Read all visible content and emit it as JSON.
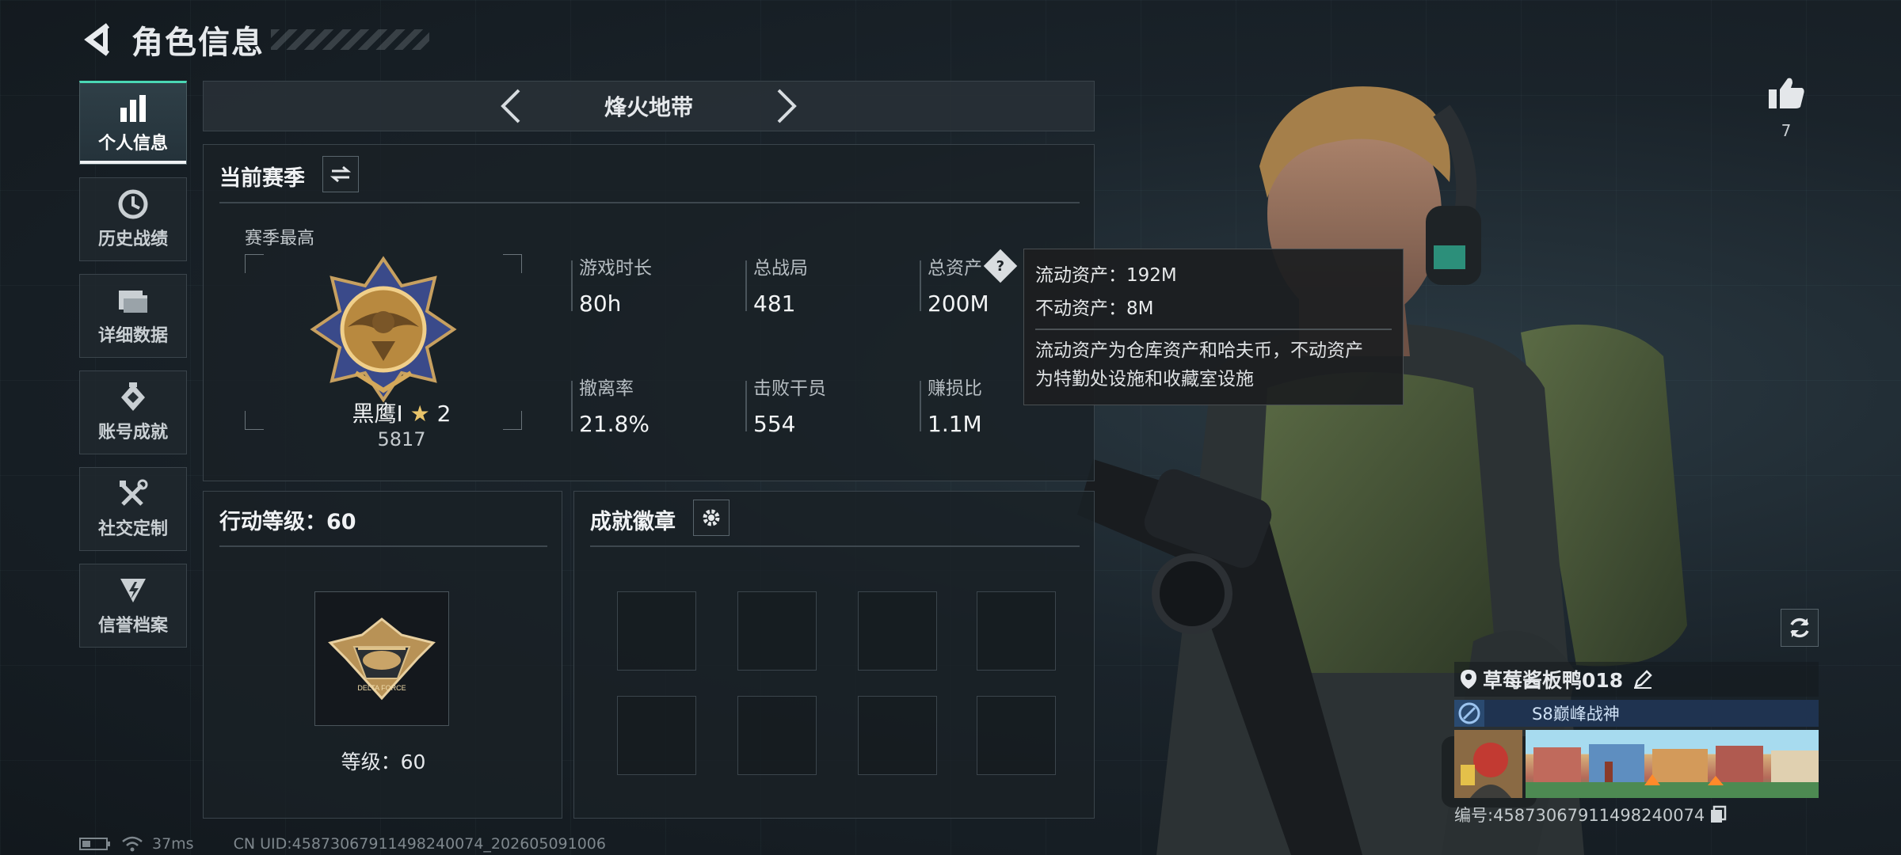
{
  "header": {
    "title": "角色信息"
  },
  "sidebar": {
    "items": [
      {
        "label": "个人信息",
        "icon": "bar-chart-icon",
        "active": true
      },
      {
        "label": "历史战绩",
        "icon": "history-clock-icon",
        "active": false
      },
      {
        "label": "详细数据",
        "icon": "folder-icon",
        "active": false
      },
      {
        "label": "账号成就",
        "icon": "achievement-diamond-icon",
        "active": false
      },
      {
        "label": "社交定制",
        "icon": "tools-icon",
        "active": false
      },
      {
        "label": "信誉档案",
        "icon": "credit-shield-icon",
        "active": false
      }
    ]
  },
  "mode": {
    "name": "烽火地带"
  },
  "season": {
    "title": "当前赛季",
    "best_label": "赛季最高",
    "rank_name": "黑鹰I",
    "rank_stars": "2",
    "rank_points": "5817",
    "stats": [
      {
        "label": "游戏时长",
        "value": "80h"
      },
      {
        "label": "总战局",
        "value": "481"
      },
      {
        "label": "总资产",
        "value": "200M"
      },
      {
        "label": "撤离率",
        "value": "21.8%"
      },
      {
        "label": "击败干员",
        "value": "554"
      },
      {
        "label": "赚损比",
        "value": "1.1M"
      }
    ]
  },
  "tooltip": {
    "liquid": "流动资产：192M",
    "fixed": "不动资产：8M",
    "desc_line1": "流动资产为仓库资产和哈夫币，不动资产",
    "desc_line2": "为特勤处设施和收藏室设施"
  },
  "action_level": {
    "title": "行动等级：60",
    "level_text": "等级：60"
  },
  "badges": {
    "title": "成就徽章",
    "slot_count": 8
  },
  "like": {
    "count": "7"
  },
  "player": {
    "name": "草莓酱板鸭018",
    "title": "S8巅峰战神",
    "uid_label": "编号:4587306791149824007​4"
  },
  "footer": {
    "ping": "37ms",
    "uid": "CN UID:45873067911498240074_202605091006"
  },
  "colors": {
    "accent": "#4ad7b4",
    "panel_border": "#3a444b",
    "title_bg": "#1f3350"
  }
}
